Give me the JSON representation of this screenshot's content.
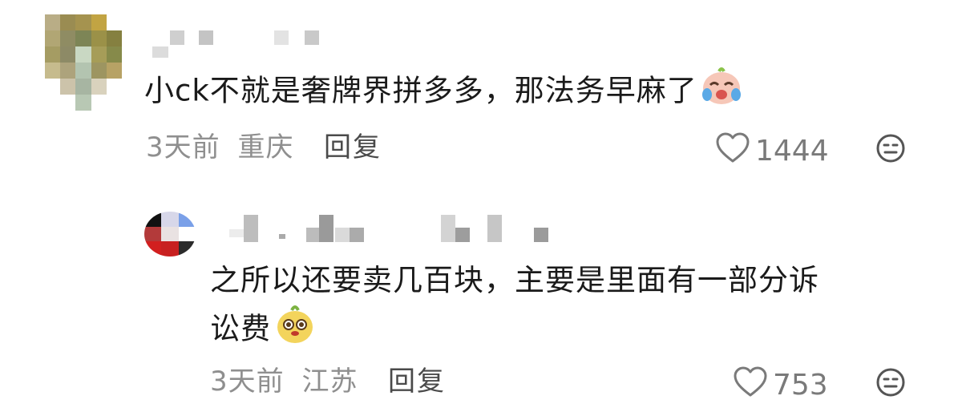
{
  "comments": [
    {
      "text": "小ck不就是奢牌界拼多多，那法务早麻了",
      "emoji": "crying-laugh-emoji",
      "time": "3天前",
      "location": "重庆",
      "reply_label": "回复",
      "likes": "1444"
    },
    {
      "text_line1": "之所以还要卖几百块，主要是里面有一部分诉",
      "text_line2": "讼费",
      "emoji": "cute-face-emoji",
      "time": "3天前",
      "location": "江苏",
      "reply_label": "回复",
      "likes": "753"
    }
  ],
  "icons": {
    "like": "heart-outline-icon",
    "more": "face-more-icon"
  }
}
